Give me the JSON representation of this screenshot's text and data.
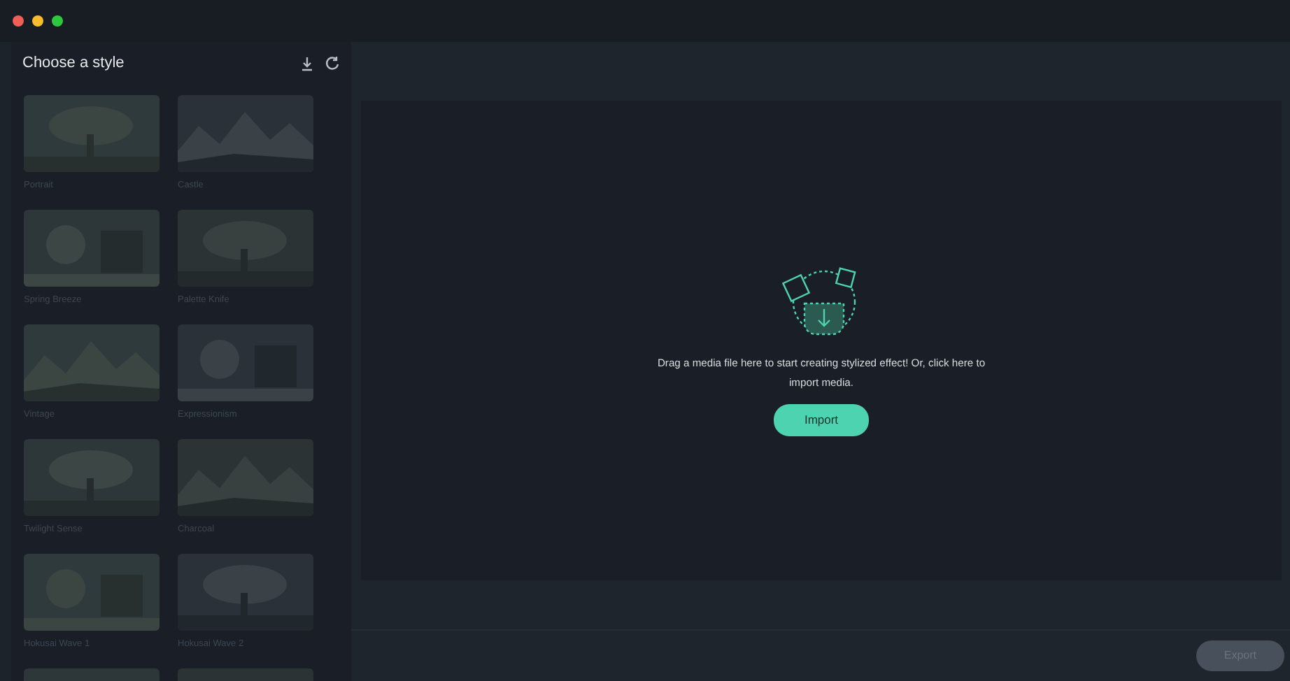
{
  "window": {
    "controls": [
      {
        "color": "#ee5f58"
      },
      {
        "color": "#f7bd2e"
      },
      {
        "color": "#2ec840"
      }
    ]
  },
  "sidebar": {
    "title": "Choose a style",
    "styles": [
      {
        "name": "Portrait",
        "kind": "picture"
      },
      {
        "name": "Castle",
        "kind": "picture"
      },
      {
        "name": "Spring Breeze",
        "kind": "picture"
      },
      {
        "name": "Palette Knife",
        "kind": "picture"
      },
      {
        "name": "Vintage",
        "kind": "picture"
      },
      {
        "name": "Expressionism",
        "kind": "picture"
      },
      {
        "name": "Twilight Sense",
        "kind": "picture"
      },
      {
        "name": "Charcoal",
        "kind": "picture"
      },
      {
        "name": "Hokusai Wave 1",
        "kind": "picture"
      },
      {
        "name": "Hokusai Wave 2",
        "kind": "picture"
      },
      {
        "kind": "picture"
      },
      {
        "kind": "picture"
      }
    ]
  },
  "dropzone": {
    "message": "Drag a media file here to start creating stylized effect! Or, click here to import media.",
    "button": "Import"
  },
  "footer": {
    "button": {
      "label": "Export",
      "disabled": true
    }
  }
}
